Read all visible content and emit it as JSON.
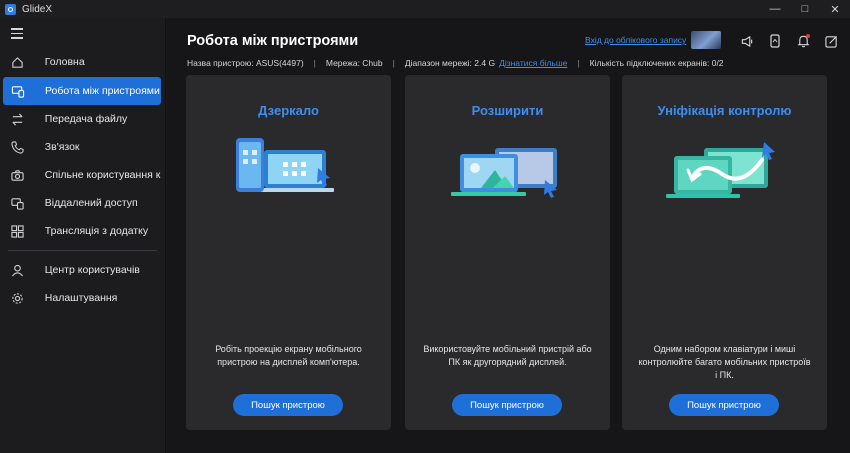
{
  "app": {
    "title": "GlideX"
  },
  "sidebar": {
    "items": [
      {
        "label": "Головна",
        "icon": "home-icon"
      },
      {
        "label": "Робота між пристроями",
        "icon": "devices-icon"
      },
      {
        "label": "Передача файлу",
        "icon": "transfer-icon"
      },
      {
        "label": "Зв'язок",
        "icon": "phone-icon"
      },
      {
        "label": "Спільне користування ка...",
        "icon": "camera-icon"
      },
      {
        "label": "Віддалений доступ",
        "icon": "remote-icon"
      },
      {
        "label": "Трансляція з додатку",
        "icon": "apps-icon"
      },
      {
        "label": "Центр користувачів",
        "icon": "user-icon"
      },
      {
        "label": "Налаштування",
        "icon": "gear-icon"
      }
    ],
    "active_index": 1
  },
  "header": {
    "title": "Робота між пристроями",
    "login_link": "Вхід до облікового запису"
  },
  "info": {
    "device_name": "Назва пристрою: ASUS(4497)",
    "network": "Мережа: Chub",
    "band": "Діапазон мережі: 2.4 G",
    "learn_more": "Дізнатися більше",
    "screens": "Кількість підключених екранів: 0/2"
  },
  "cards": [
    {
      "title": "Дзеркало",
      "desc": "Робіть проекцію екрану мобільного пристрою на дисплей комп'ютера.",
      "button": "Пошук пристрою"
    },
    {
      "title": "Розширити",
      "desc": "Використовуйте мобільний пристрій або ПК як другорядний дисплей.",
      "button": "Пошук пристрою"
    },
    {
      "title": "Уніфікація контролю",
      "desc": "Одним набором клавіатури і миші контролюйте багато мобільних пристроїв і ПК.",
      "button": "Пошук пристрою"
    }
  ],
  "colors": {
    "accent": "#1f6fd8",
    "link": "#3d8ef0",
    "card_bg": "#2a2a2d",
    "notification_dot": "#e53935"
  }
}
